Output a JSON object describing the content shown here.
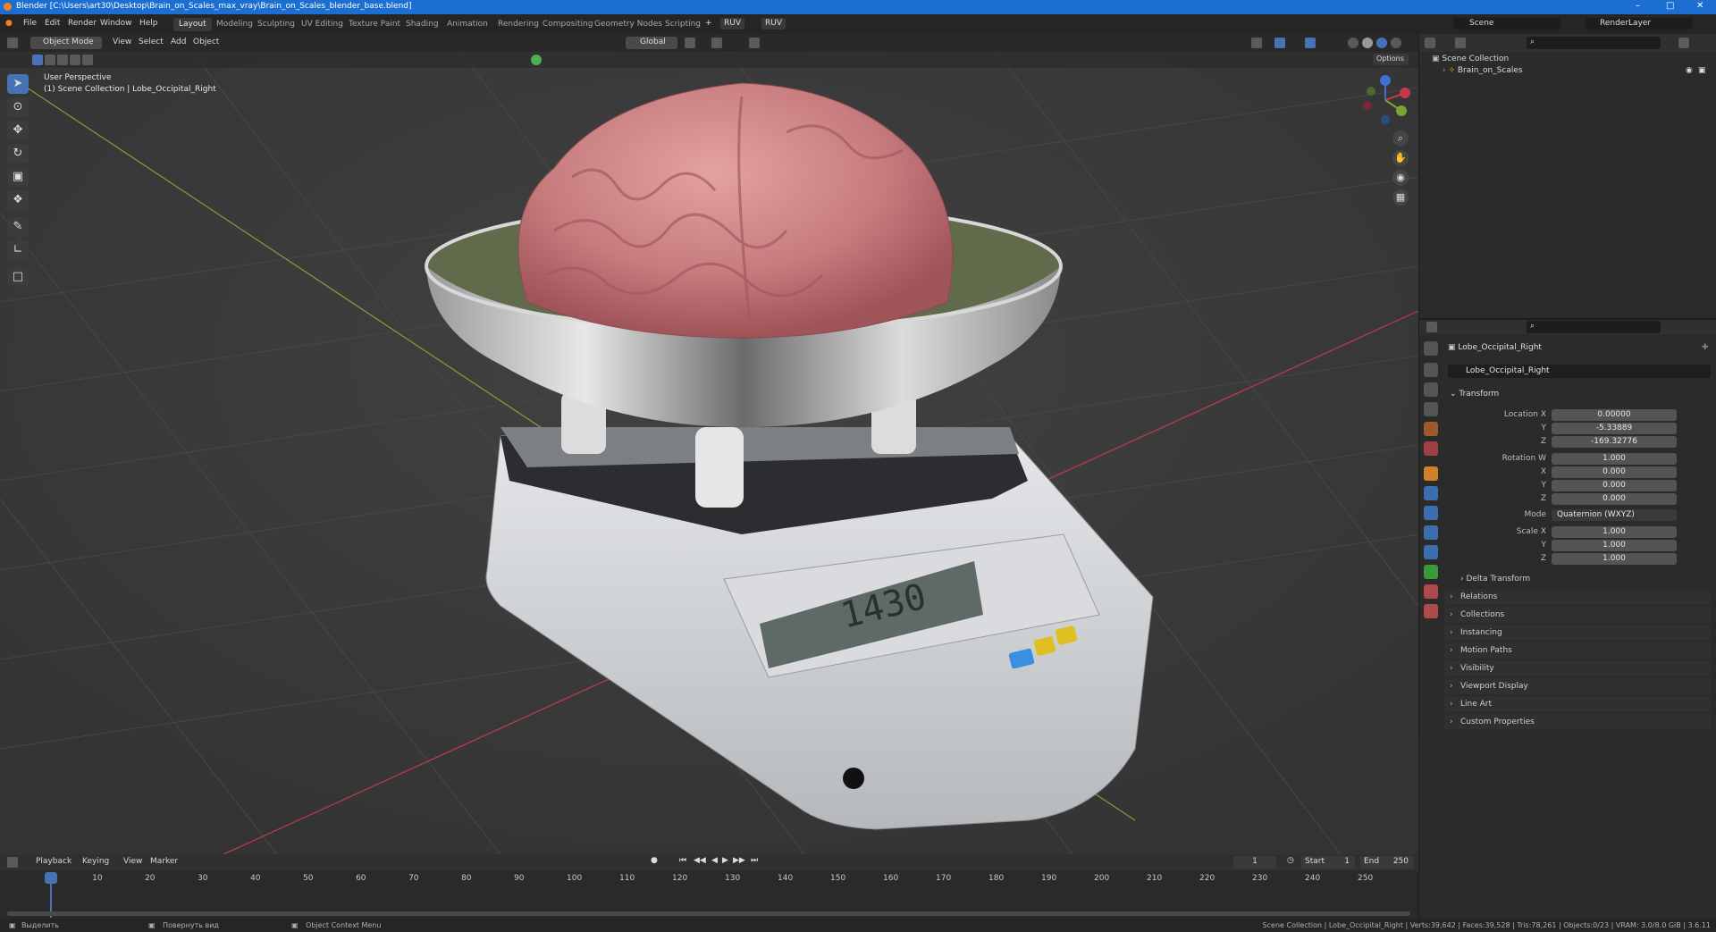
{
  "window": {
    "title": "Blender [C:\\Users\\art30\\Desktop\\Brain_on_Scales_max_vray\\Brain_on_Scales_blender_base.blend]"
  },
  "menus": [
    "File",
    "Edit",
    "Render",
    "Window",
    "Help"
  ],
  "workspaces": [
    "Layout",
    "Modeling",
    "Sculpting",
    "UV Editing",
    "Texture Paint",
    "Shading",
    "Animation",
    "Rendering",
    "Compositing",
    "Geometry Nodes",
    "Scripting"
  ],
  "active_workspace": "Layout",
  "extra_tabs": [
    "RUV",
    "RUV"
  ],
  "scene": {
    "name": "Scene",
    "view_layer": "RenderLayer"
  },
  "viewport": {
    "mode": "Object Mode",
    "menus": [
      "View",
      "Select",
      "Add",
      "Object"
    ],
    "orientation": "Global",
    "options_label": "Options",
    "overlay_text": {
      "view": "User Perspective",
      "context": "(1) Scene Collection | Lobe_Occipital_Right"
    },
    "scale_display": "1430"
  },
  "outliner": {
    "root": "Scene Collection",
    "items": [
      {
        "name": "Brain_on_Scales"
      }
    ]
  },
  "properties": {
    "object_name": "Lobe_Occipital_Right",
    "data_name": "Lobe_Occipital_Right",
    "transform_label": "Transform",
    "location_label": "Location X",
    "location": {
      "x": "0.00000",
      "y": "-5.33889",
      "z": "-169.32776"
    },
    "rotation_label": "Rotation W",
    "rotation": {
      "w": "1.000",
      "x": "0.000",
      "y": "0.000",
      "z": "0.000"
    },
    "mode_label": "Mode",
    "mode": "Quaternion (WXYZ)",
    "scale_label": "Scale X",
    "scale": {
      "x": "1.000",
      "y": "1.000",
      "z": "1.000"
    },
    "axis": {
      "x": "X",
      "y": "Y",
      "z": "Z"
    },
    "delta_transform": "Delta Transform",
    "panels": [
      "Relations",
      "Collections",
      "Instancing",
      "Motion Paths",
      "Visibility",
      "Viewport Display",
      "Line Art",
      "Custom Properties"
    ]
  },
  "timeline": {
    "menus": [
      "Playback",
      "Keying",
      "View",
      "Marker"
    ],
    "current_frame": "1",
    "start_label": "Start",
    "start": "1",
    "end_label": "End",
    "end": "250",
    "ticks": [
      "1",
      "10",
      "20",
      "30",
      "40",
      "50",
      "60",
      "70",
      "80",
      "90",
      "100",
      "110",
      "120",
      "130",
      "140",
      "150",
      "160",
      "170",
      "180",
      "190",
      "200",
      "210",
      "220",
      "230",
      "240",
      "250"
    ]
  },
  "status": {
    "left": [
      "Выделить",
      "Повернуть вид",
      "Object Context Menu"
    ],
    "right": "Scene Collection | Lobe_Occipital_Right | Verts:39,642 | Faces:39,528 | Tris:78,261 | Objects:0/23 | VRAM: 3.0/8.0 GiB | 3.6.11"
  },
  "colors": {
    "accent": "#4772b3",
    "titlebar": "#1c6fd1",
    "x_axis": "#c43a4a",
    "y_axis": "#7aa43a",
    "z_axis": "#3f6fcf"
  }
}
